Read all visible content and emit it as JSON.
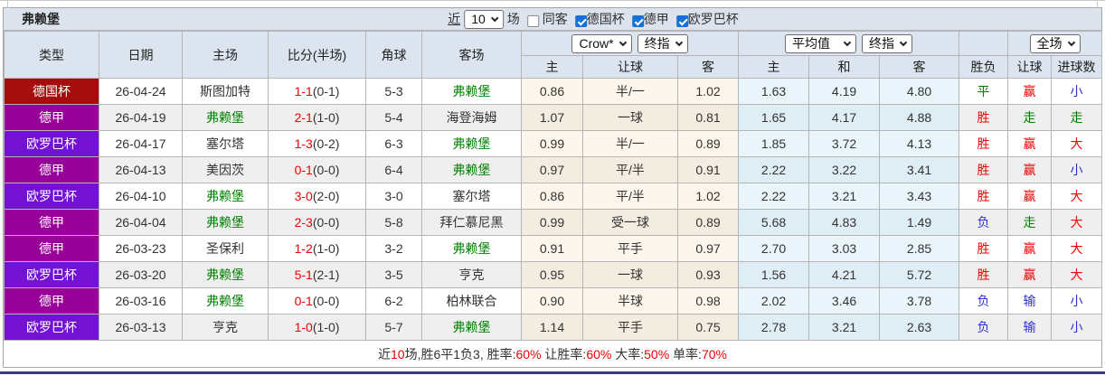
{
  "title": "弗赖堡",
  "filters": {
    "recent_prefix": "近",
    "recent_value": "10",
    "recent_suffix": "场",
    "checkboxes": [
      {
        "label": "同客",
        "checked": false
      },
      {
        "label": "德国杯",
        "checked": true
      },
      {
        "label": "德甲",
        "checked": true
      },
      {
        "label": "欧罗巴杯",
        "checked": true
      }
    ]
  },
  "header": {
    "left_columns": [
      "类型",
      "日期",
      "主场",
      "比分(半场)",
      "角球",
      "客场"
    ],
    "crow_select": "Crow*",
    "crow_index_select": "终指",
    "avg_select": "平均值",
    "avg_index_select": "终指",
    "fullmatch_select": "全场",
    "sub_columns_crow": [
      "主",
      "让球",
      "客"
    ],
    "sub_columns_avg": [
      "主",
      "和",
      "客"
    ],
    "sub_columns_result": [
      "胜负",
      "让球",
      "进球数"
    ]
  },
  "colors": {
    "type_colors": {
      "德国杯": "#a50d0d",
      "德甲": "#990099",
      "欧罗巴杯": "#7412d4"
    },
    "result_colors": {
      "胜": "#f00000",
      "平": "#008000",
      "负": "#3030d6",
      "赢": "#f00000",
      "走": "#008000",
      "输": "#3030d6",
      "大": "#f00000",
      "小": "#3030d6"
    },
    "checkbox_checked": "#1573d6",
    "bottom_line": "#3b3a85",
    "team_highlight": "#008000"
  },
  "highlight_team": "弗赖堡",
  "rows": [
    {
      "type": "德国杯",
      "date": "26-04-24",
      "home": "斯图加特",
      "score": "1-1",
      "half": "(0-1)",
      "corner": "5-3",
      "away": "弗赖堡",
      "crow": [
        "0.86",
        "半/一",
        "1.02"
      ],
      "avg": [
        "1.63",
        "4.19",
        "4.80"
      ],
      "results": [
        "平",
        "赢",
        "小"
      ]
    },
    {
      "type": "德甲",
      "date": "26-04-19",
      "home": "弗赖堡",
      "score": "2-1",
      "half": "(1-0)",
      "corner": "5-4",
      "away": "海登海姆",
      "crow": [
        "1.07",
        "一球",
        "0.81"
      ],
      "avg": [
        "1.65",
        "4.17",
        "4.88"
      ],
      "results": [
        "胜",
        "走",
        "走"
      ]
    },
    {
      "type": "欧罗巴杯",
      "date": "26-04-17",
      "home": "塞尔塔",
      "score": "1-3",
      "half": "(0-2)",
      "corner": "6-3",
      "away": "弗赖堡",
      "crow": [
        "0.99",
        "半/一",
        "0.89"
      ],
      "avg": [
        "1.85",
        "3.72",
        "4.13"
      ],
      "results": [
        "胜",
        "赢",
        "大"
      ]
    },
    {
      "type": "德甲",
      "date": "26-04-13",
      "home": "美因茨",
      "score": "0-1",
      "half": "(0-0)",
      "corner": "6-4",
      "away": "弗赖堡",
      "crow": [
        "0.97",
        "平/半",
        "0.91"
      ],
      "avg": [
        "2.22",
        "3.22",
        "3.41"
      ],
      "results": [
        "胜",
        "赢",
        "小"
      ]
    },
    {
      "type": "欧罗巴杯",
      "date": "26-04-10",
      "home": "弗赖堡",
      "score": "3-0",
      "half": "(2-0)",
      "corner": "3-0",
      "away": "塞尔塔",
      "crow": [
        "0.86",
        "平/半",
        "1.02"
      ],
      "avg": [
        "2.22",
        "3.21",
        "3.43"
      ],
      "results": [
        "胜",
        "赢",
        "大"
      ]
    },
    {
      "type": "德甲",
      "date": "26-04-04",
      "home": "弗赖堡",
      "score": "2-3",
      "half": "(0-0)",
      "corner": "5-8",
      "away": "拜仁慕尼黑",
      "crow": [
        "0.99",
        "受一球",
        "0.89"
      ],
      "avg": [
        "5.68",
        "4.83",
        "1.49"
      ],
      "results": [
        "负",
        "走",
        "大"
      ]
    },
    {
      "type": "德甲",
      "date": "26-03-23",
      "home": "圣保利",
      "score": "1-2",
      "half": "(1-0)",
      "corner": "3-2",
      "away": "弗赖堡",
      "crow": [
        "0.91",
        "平手",
        "0.97"
      ],
      "avg": [
        "2.70",
        "3.03",
        "2.85"
      ],
      "results": [
        "胜",
        "赢",
        "大"
      ]
    },
    {
      "type": "欧罗巴杯",
      "date": "26-03-20",
      "home": "弗赖堡",
      "score": "5-1",
      "half": "(2-1)",
      "corner": "3-5",
      "away": "亨克",
      "crow": [
        "0.95",
        "一球",
        "0.93"
      ],
      "avg": [
        "1.56",
        "4.21",
        "5.72"
      ],
      "results": [
        "胜",
        "赢",
        "大"
      ]
    },
    {
      "type": "德甲",
      "date": "26-03-16",
      "home": "弗赖堡",
      "score": "0-1",
      "half": "(0-0)",
      "corner": "6-2",
      "away": "柏林联合",
      "crow": [
        "0.90",
        "半球",
        "0.98"
      ],
      "avg": [
        "2.02",
        "3.46",
        "3.78"
      ],
      "results": [
        "负",
        "输",
        "小"
      ]
    },
    {
      "type": "欧罗巴杯",
      "date": "26-03-13",
      "home": "亨克",
      "score": "1-0",
      "half": "(1-0)",
      "corner": "5-7",
      "away": "弗赖堡",
      "crow": [
        "1.14",
        "平手",
        "0.75"
      ],
      "avg": [
        "2.78",
        "3.21",
        "2.63"
      ],
      "results": [
        "负",
        "输",
        "小"
      ]
    }
  ],
  "footer": {
    "segments": [
      {
        "text": "近",
        "color": "#333333"
      },
      {
        "text": "10",
        "color": "#f00000"
      },
      {
        "text": "场,胜6平1负3, 胜率:",
        "color": "#333333"
      },
      {
        "text": "60%",
        "color": "#f00000"
      },
      {
        "text": " 让胜率:",
        "color": "#333333"
      },
      {
        "text": "60%",
        "color": "#f00000"
      },
      {
        "text": " 大率:",
        "color": "#333333"
      },
      {
        "text": "50%",
        "color": "#f00000"
      },
      {
        "text": " 单率:",
        "color": "#333333"
      },
      {
        "text": "70%",
        "color": "#f00000"
      }
    ]
  }
}
